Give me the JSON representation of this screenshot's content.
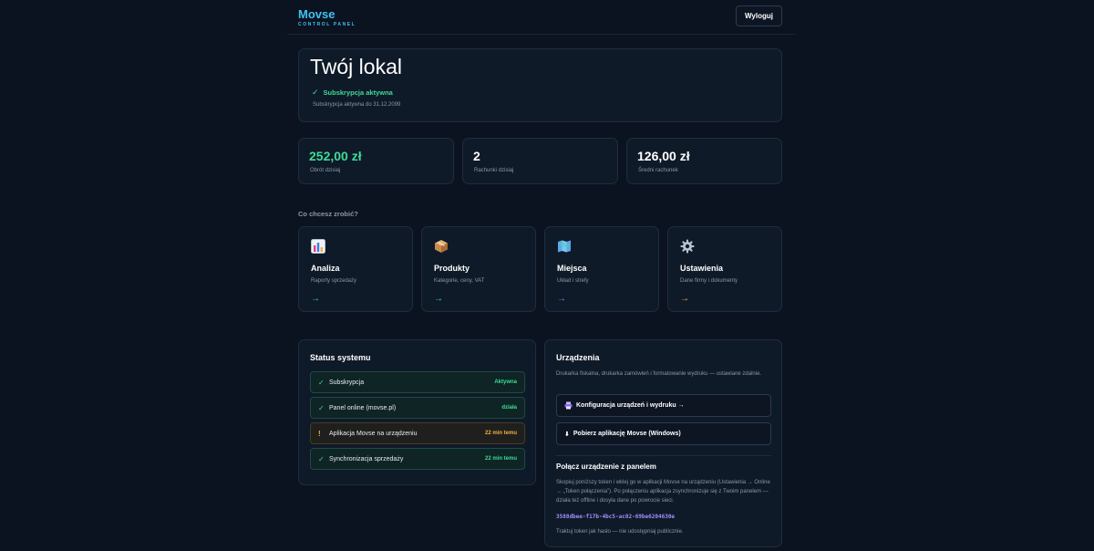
{
  "header": {
    "brand_name": "Movse",
    "brand_sub": "CONTROL PANEL",
    "logout_label": "Wyloguj"
  },
  "hero": {
    "title": "Twój lokal",
    "subscription_status": "Subskrypcja aktywna",
    "subscription_until": "Subskrypcja aktywna do 31.12.2099",
    "status_color": "#3ddc97"
  },
  "stats": [
    {
      "value": "252,00 zł",
      "label": "Obrót dzisiaj"
    },
    {
      "value": "2",
      "label": "Rachunki dzisiaj"
    },
    {
      "value": "126,00 zł",
      "label": "Średni rachunek"
    }
  ],
  "actions_heading": "Co chcesz zrobić?",
  "actions": [
    {
      "title": "Analiza",
      "desc": "Raporty sprzedaży",
      "arrow": "→",
      "icon": "chart-icon",
      "arrow_color": "#3fc2ee"
    },
    {
      "title": "Produkty",
      "desc": "Kategorie, ceny, VAT",
      "arrow": "→",
      "icon": "package-icon",
      "arrow_color": "#3fc2ee"
    },
    {
      "title": "Miejsca",
      "desc": "Układ i strefy",
      "arrow": "→",
      "icon": "map-icon",
      "arrow_color": "#5b8cff"
    },
    {
      "title": "Ustawienia",
      "desc": "Dane firmy i dokumenty",
      "arrow": "→",
      "icon": "gear-icon",
      "arrow_color": "#f2b13b"
    }
  ],
  "system_status": {
    "title": "Status systemu",
    "rows": [
      {
        "mark": "✓",
        "label": "Subskrypcja",
        "value": "Aktywna",
        "state": "ok"
      },
      {
        "mark": "✓",
        "label": "Panel online (movse.pl)",
        "value": "działa",
        "state": "ok"
      },
      {
        "mark": "!",
        "label": "Aplikacja Movse na urządzeniu",
        "value": "22 min temu",
        "state": "warn"
      },
      {
        "mark": "✓",
        "label": "Synchronizacja sprzedaży",
        "value": "22 min temu",
        "state": "ok"
      }
    ]
  },
  "devices": {
    "title": "Urządzenia",
    "desc": "Drukarka fiskalna, drukarka zamówień i formatowanie wydruku — ustawiane zdalnie.",
    "config_button": "Konfiguracja urządzeń i wydruku →",
    "download_button": "Pobierz aplikację Movse (Windows)",
    "connect_title": "Połącz urządzenie z panelem",
    "connect_desc": "Skopiuj poniższy token i wklej go w aplikacji Movse na urządzeniu (Ustawienia → Online → „Token połączenia”). Po połączeniu aplikacja zsynchronizuje się z Twoim panelem — działa też offline i dosyła dane po powrocie sieci.",
    "token": "3588dbee-f17b-4bc5-ac02-69be6204630e",
    "token_note": "Traktuj token jak hasło — nie udostępniaj publicznie."
  }
}
